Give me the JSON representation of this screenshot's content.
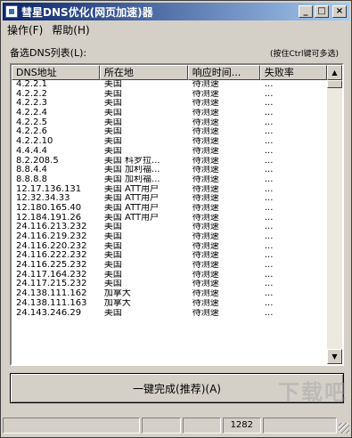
{
  "window": {
    "title": "彗星DNS优化(网页加速)器",
    "minimize_glyph": "_",
    "maximize_glyph": "□",
    "close_glyph": "×"
  },
  "menu": [
    "操作(F)",
    "帮助(H)"
  ],
  "list_caption": "备选DNS列表(L):",
  "multi_select_hint": "(按住Ctrl键可多选)",
  "columns": [
    "DNS地址",
    "所在地",
    "响应时间...",
    "失败率"
  ],
  "rows": [
    [
      "4.2.2.1",
      "美国",
      "待测速",
      "..."
    ],
    [
      "4.2.2.2",
      "美国",
      "待测速",
      "..."
    ],
    [
      "4.2.2.3",
      "美国",
      "待测速",
      "..."
    ],
    [
      "4.2.2.4",
      "美国",
      "待测速",
      "..."
    ],
    [
      "4.2.2.5",
      "美国",
      "待测速",
      "..."
    ],
    [
      "4.2.2.6",
      "美国",
      "待测速",
      "..."
    ],
    [
      "4.2.2.10",
      "美国",
      "待测速",
      "..."
    ],
    [
      "4.4.4.4",
      "美国",
      "待测速",
      "..."
    ],
    [
      "8.2.208.5",
      "美国 科罗拉...",
      "待测速",
      "..."
    ],
    [
      "8.8.4.4",
      "美国 加利福...",
      "待测速",
      "..."
    ],
    [
      "8.8.8.8",
      "美国 加利福...",
      "待测速",
      "..."
    ],
    [
      "12.17.136.131",
      "美国 ATT用户",
      "待测速",
      "..."
    ],
    [
      "12.32.34.33",
      "美国 ATT用户",
      "待测速",
      "..."
    ],
    [
      "12.180.165.40",
      "美国 ATT用户",
      "待测速",
      "..."
    ],
    [
      "12.184.191.26",
      "美国 ATT用户",
      "待测速",
      "..."
    ],
    [
      "24.116.213.232",
      "美国",
      "待测速",
      "..."
    ],
    [
      "24.116.219.232",
      "美国",
      "待测速",
      "..."
    ],
    [
      "24.116.220.232",
      "美国",
      "待测速",
      "..."
    ],
    [
      "24.116.222.232",
      "美国",
      "待测速",
      "..."
    ],
    [
      "24.116.225.232",
      "美国",
      "待测速",
      "..."
    ],
    [
      "24.117.164.232",
      "美国",
      "待测速",
      "..."
    ],
    [
      "24.117.215.232",
      "美国",
      "待测速",
      "..."
    ],
    [
      "24.138.111.162",
      "加拿大",
      "待测速",
      "..."
    ],
    [
      "24.138.111.163",
      "加拿大",
      "待测速",
      "..."
    ],
    [
      "24.143.246.29",
      "美国",
      "待测速",
      "..."
    ]
  ],
  "action_button": "一键完成(推荐)(A)",
  "status": [
    "",
    "",
    "",
    "1282",
    ""
  ],
  "watermark": "下载吧"
}
